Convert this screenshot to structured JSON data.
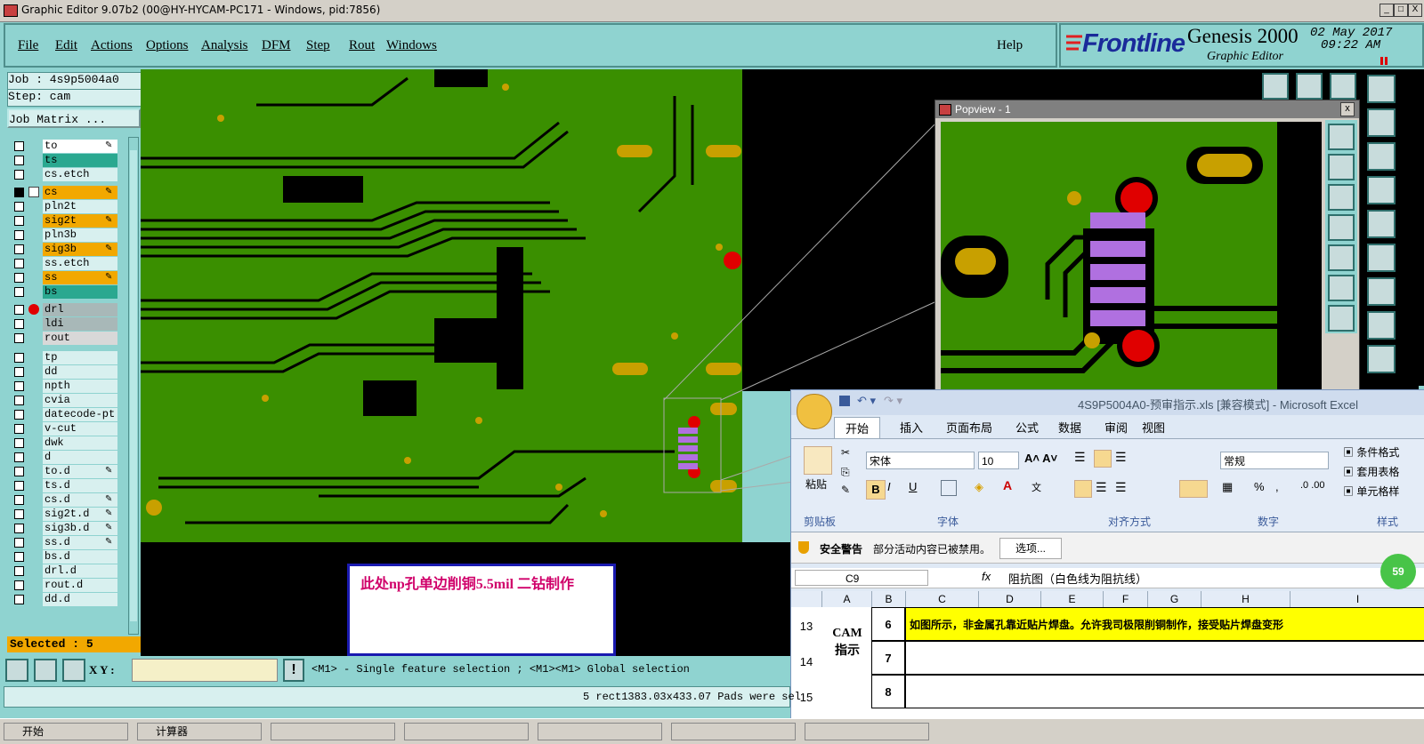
{
  "window": {
    "title": "Graphic Editor 9.07b2 (00@HY-HYCAM-PC171 - Windows, pid:7856)",
    "min_label": "_",
    "max_label": "□",
    "close_label": "X"
  },
  "menu": {
    "items": [
      "File",
      "Edit",
      "Actions",
      "Options",
      "Analysis",
      "DFM",
      "Step",
      "Rout",
      "Windows"
    ],
    "help": "Help"
  },
  "brand": {
    "logo": "Frontline",
    "product": "Genesis 2000",
    "subtitle": "Graphic Editor",
    "date": "02 May 2017",
    "time": "09:22 AM"
  },
  "job": {
    "job_label": "Job : 4s9p5004a0",
    "step_label": "Step: cam",
    "matrix_button": "Job Matrix ..."
  },
  "layers": [
    {
      "name": "to",
      "bg": "#ffffff",
      "mark": "pen"
    },
    {
      "name": "ts",
      "bg": "#2aa890",
      "mark": ""
    },
    {
      "name": "cs.etch",
      "bg": "#d8f0ef",
      "mark": ""
    },
    {
      "name": "cs",
      "bg": "#f2a800",
      "mark": "pen",
      "selected": true
    },
    {
      "name": "pln2t",
      "bg": "#d8f0ef",
      "mark": ""
    },
    {
      "name": "sig2t",
      "bg": "#f2a800",
      "mark": "pen"
    },
    {
      "name": "pln3b",
      "bg": "#d8f0ef",
      "mark": ""
    },
    {
      "name": "sig3b",
      "bg": "#f2a800",
      "mark": "pen"
    },
    {
      "name": "ss.etch",
      "bg": "#d8f0ef",
      "mark": ""
    },
    {
      "name": "ss",
      "bg": "#f2a800",
      "mark": "pen"
    },
    {
      "name": "bs",
      "bg": "#2aa890",
      "mark": ""
    },
    {
      "name": "drl",
      "bg": "#a8b8b8",
      "mark": "",
      "dot": true
    },
    {
      "name": "ldi",
      "bg": "#a8b8b8",
      "mark": ""
    },
    {
      "name": "rout",
      "bg": "#d8d8d8",
      "mark": ""
    },
    {
      "name": "tp",
      "bg": "#d8f0ef",
      "mark": ""
    },
    {
      "name": "dd",
      "bg": "#d8f0ef",
      "mark": ""
    },
    {
      "name": "npth",
      "bg": "#d8f0ef",
      "mark": ""
    },
    {
      "name": "cvia",
      "bg": "#d8f0ef",
      "mark": ""
    },
    {
      "name": "datecode-pt",
      "bg": "#d8f0ef",
      "mark": ""
    },
    {
      "name": "v-cut",
      "bg": "#d8f0ef",
      "mark": ""
    },
    {
      "name": "dwk",
      "bg": "#d8f0ef",
      "mark": ""
    },
    {
      "name": "d",
      "bg": "#d8f0ef",
      "mark": ""
    },
    {
      "name": "to.d",
      "bg": "#d8f0ef",
      "mark": "pen"
    },
    {
      "name": "ts.d",
      "bg": "#d8f0ef",
      "mark": ""
    },
    {
      "name": "cs.d",
      "bg": "#d8f0ef",
      "mark": "pen"
    },
    {
      "name": "sig2t.d",
      "bg": "#d8f0ef",
      "mark": "pen"
    },
    {
      "name": "sig3b.d",
      "bg": "#d8f0ef",
      "mark": "pen"
    },
    {
      "name": "ss.d",
      "bg": "#d8f0ef",
      "mark": "pen"
    },
    {
      "name": "bs.d",
      "bg": "#d8f0ef",
      "mark": ""
    },
    {
      "name": "drl.d",
      "bg": "#d8f0ef",
      "mark": ""
    },
    {
      "name": "rout.d",
      "bg": "#d8f0ef",
      "mark": ""
    },
    {
      "name": "dd.d",
      "bg": "#d8f0ef",
      "mark": ""
    }
  ],
  "selected": "Selected : 5",
  "annotation": "此处np孔单边削铜5.5mil  二钻制作",
  "popview_title": "Popview - 1",
  "xy_label": "X Y :",
  "hint": "<M1> - Single feature selection ; <M1><M1> Global selection",
  "status": "5 rect1383.03x433.07 Pads were sel",
  "excel": {
    "title": "4S9P5004A0-预审指示.xls  [兼容模式] - Microsoft Excel",
    "tabs": [
      "开始",
      "插入",
      "页面布局",
      "公式",
      "数据",
      "审阅",
      "视图"
    ],
    "paste": "粘贴",
    "font_name": "宋体",
    "font_size": "10",
    "number_format": "常规",
    "group_clipboard": "剪贴板",
    "group_font": "字体",
    "group_align": "对齐方式",
    "group_number": "数字",
    "group_style": "样式",
    "side_items": [
      "条件格式",
      "套用表格",
      "单元格样"
    ],
    "security_label": "安全警告",
    "security_text": "部分活动内容已被禁用。",
    "options_button": "选项...",
    "cell_ref": "C9",
    "fx": "fx",
    "formula": "阻抗图（白色线为阻抗线）",
    "columns": [
      "A",
      "B",
      "C",
      "D",
      "E",
      "F",
      "G",
      "H",
      "I"
    ],
    "row_headers": [
      "13",
      "14",
      "15"
    ],
    "cam_label": "CAM 指示",
    "rows": [
      {
        "num": "6",
        "text": "如图所示，非金属孔靠近贴片焊盘。允许我司极限削铜制作，接受贴片焊盘变形"
      },
      {
        "num": "7",
        "text": ""
      },
      {
        "num": "8",
        "text": ""
      }
    ],
    "badge": "59"
  },
  "taskbar_items": [
    "开始",
    "计算器",
    "",
    "",
    "",
    "",
    ""
  ]
}
